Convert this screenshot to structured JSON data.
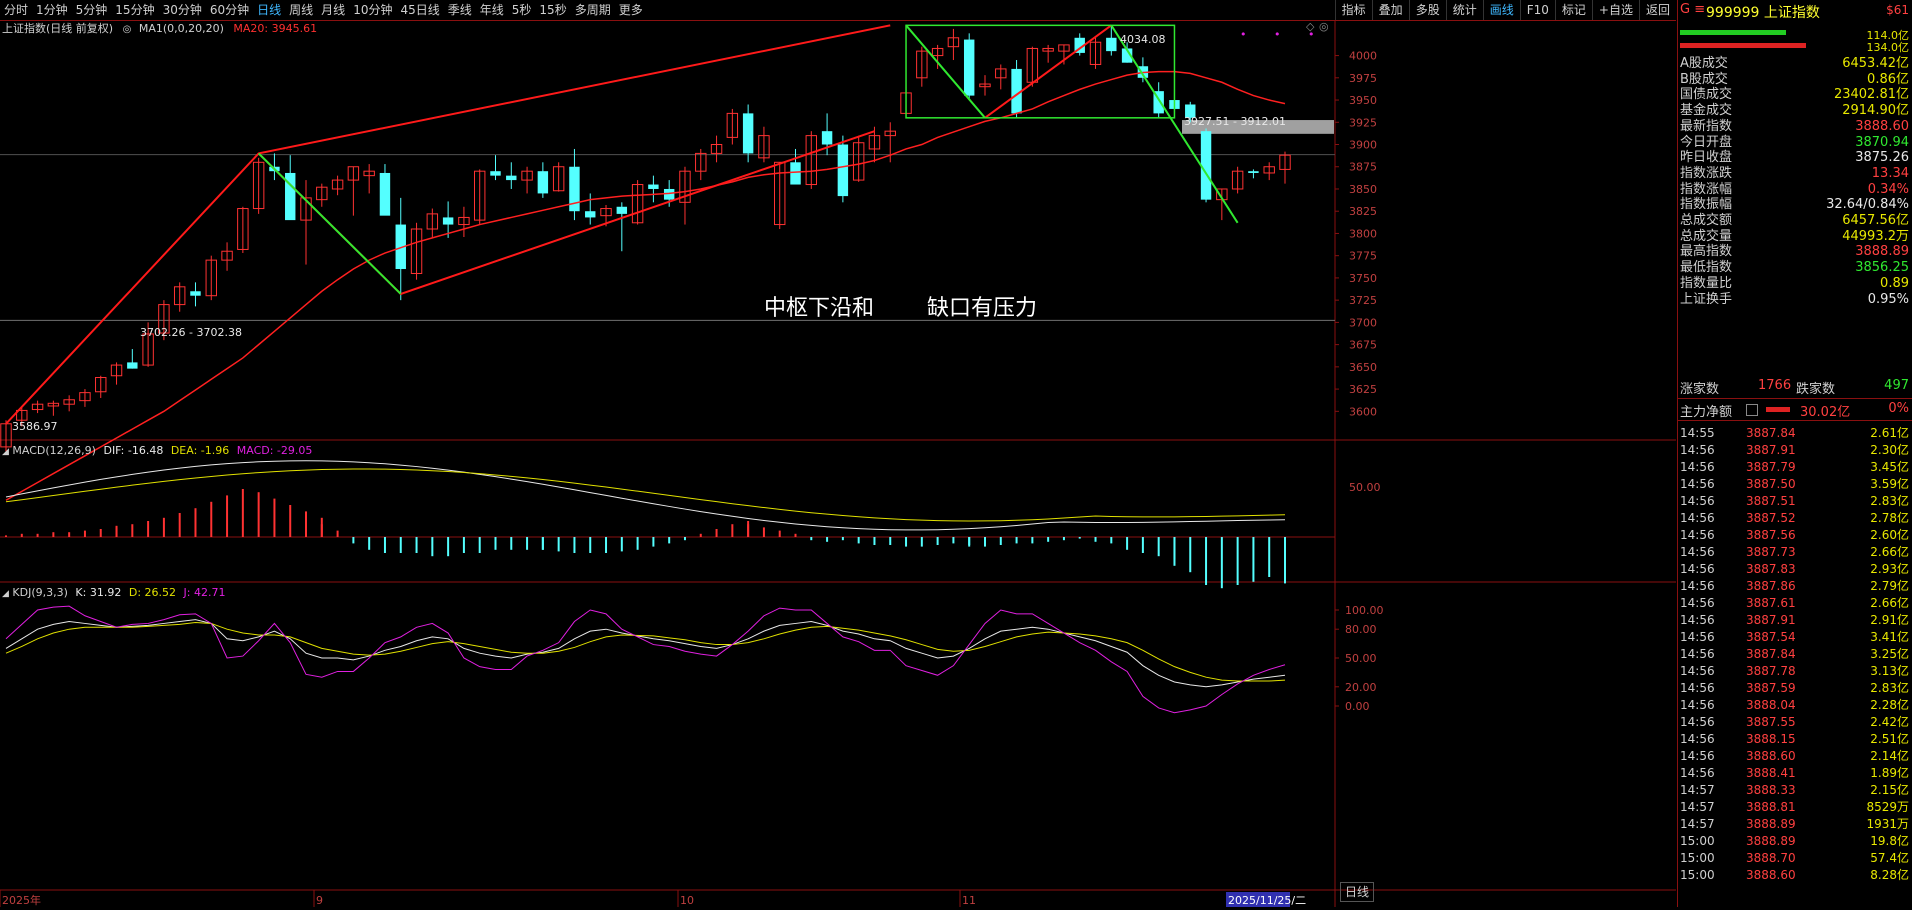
{
  "toolbar": {
    "periods": [
      "分时",
      "1分钟",
      "5分钟",
      "15分钟",
      "30分钟",
      "60分钟",
      "日线",
      "周线",
      "月线",
      "10分钟",
      "45日线",
      "季线",
      "年线",
      "5秒",
      "15秒",
      "多周期",
      "更多"
    ],
    "active_period": "日线",
    "tools": [
      "指标",
      "叠加",
      "多股",
      "统计",
      "画线",
      "F10",
      "标记",
      "+自选",
      "返回"
    ],
    "active_tool": "画线"
  },
  "legend": {
    "title": "上证指数(日线 前复权)",
    "ma1": "MA1(0,0,20,20)",
    "ma20": "MA20: 3945.61"
  },
  "annotations": {
    "text_main": "中枢下沿和",
    "text_gap": "缺口有压力",
    "high_label": "4034.08",
    "gap_label": "3927.51 - 3912.01",
    "zone_label": "3702.26 - 3702.38",
    "low_label": "3586.97"
  },
  "macd": {
    "name": "MACD(12,26,9)",
    "dif": "DIF: -16.48",
    "dea": "DEA: -1.96",
    "macd": "MACD: -29.05"
  },
  "kdj": {
    "name": "KDJ(9,3,3)",
    "k": "K: 31.92",
    "d": "D: 26.52",
    "j": "J: 42.71"
  },
  "x_labels": [
    "2025年",
    "9",
    "10",
    "11",
    "2025/11/25/二"
  ],
  "y_axis": {
    "price": [
      "4000",
      "3975",
      "3950",
      "3925",
      "3900",
      "3875",
      "3850",
      "3825",
      "3800",
      "3775",
      "3750",
      "3725",
      "3700",
      "3675",
      "3650",
      "3625",
      "3600"
    ],
    "macd": [
      "50.00"
    ],
    "kdj": [
      "100.00",
      "80.00",
      "50.00",
      "20.00",
      "0.00"
    ]
  },
  "bottom_tab": "日线",
  "colors": {
    "up": "#ff3232",
    "down": "#54ffff",
    "ma": "#ff2020",
    "green_line": "#30e830",
    "yellow": "#e0e000",
    "white": "#e8e8e8",
    "magenta": "#e020e0"
  },
  "panel": {
    "title": "999999 上证指数",
    "prefix": "G ≡",
    "badge": "$61",
    "bar_values": [
      "114.0亿",
      "134.0亿"
    ],
    "stats": [
      {
        "k": "A股成交",
        "v": "6453.42亿",
        "c": "#e8e800"
      },
      {
        "k": "B股成交",
        "v": "0.86亿",
        "c": "#e8e800"
      },
      {
        "k": "国债成交",
        "v": "23402.81亿",
        "c": "#e8e800"
      },
      {
        "k": "基金成交",
        "v": "2914.90亿",
        "c": "#e8e800"
      },
      {
        "k": "最新指数",
        "v": "3888.60",
        "c": "#ff4040"
      },
      {
        "k": "今日开盘",
        "v": "3870.94",
        "c": "#30e830"
      },
      {
        "k": "昨日收盘",
        "v": "3875.26",
        "c": "#e8e8e8"
      },
      {
        "k": "指数涨跌",
        "v": "13.34",
        "c": "#ff4040"
      },
      {
        "k": "指数涨幅",
        "v": "0.34%",
        "c": "#ff4040"
      },
      {
        "k": "指数振幅",
        "v": "32.64/0.84%",
        "c": "#e8e8e8"
      },
      {
        "k": "总成交额",
        "v": "6457.56亿",
        "c": "#e8e800"
      },
      {
        "k": "总成交量",
        "v": "44993.2万",
        "c": "#e8e800"
      },
      {
        "k": "最高指数",
        "v": "3888.89",
        "c": "#ff4040"
      },
      {
        "k": "最低指数",
        "v": "3856.25",
        "c": "#30e830"
      },
      {
        "k": "指数量比",
        "v": "0.89",
        "c": "#e8e800"
      },
      {
        "k": "上证换手",
        "v": "0.95%",
        "c": "#e8e8e8"
      }
    ],
    "up_count_label": "涨家数",
    "up_count": "1766",
    "down_count_label": "跌家数",
    "down_count": "497",
    "main_flow_label": "主力净额",
    "main_flow": "30.02亿",
    "main_flow_pct": "0%",
    "ticks": [
      {
        "t": "14:55",
        "p": "3887.84",
        "v": "2.61亿"
      },
      {
        "t": "14:56",
        "p": "3887.91",
        "v": "2.30亿"
      },
      {
        "t": "14:56",
        "p": "3887.79",
        "v": "3.45亿"
      },
      {
        "t": "14:56",
        "p": "3887.50",
        "v": "3.59亿"
      },
      {
        "t": "14:56",
        "p": "3887.51",
        "v": "2.83亿"
      },
      {
        "t": "14:56",
        "p": "3887.52",
        "v": "2.78亿"
      },
      {
        "t": "14:56",
        "p": "3887.56",
        "v": "2.60亿"
      },
      {
        "t": "14:56",
        "p": "3887.73",
        "v": "2.66亿"
      },
      {
        "t": "14:56",
        "p": "3887.83",
        "v": "2.93亿"
      },
      {
        "t": "14:56",
        "p": "3887.86",
        "v": "2.79亿"
      },
      {
        "t": "14:56",
        "p": "3887.61",
        "v": "2.66亿"
      },
      {
        "t": "14:56",
        "p": "3887.91",
        "v": "2.91亿"
      },
      {
        "t": "14:56",
        "p": "3887.54",
        "v": "3.41亿"
      },
      {
        "t": "14:56",
        "p": "3887.84",
        "v": "3.25亿"
      },
      {
        "t": "14:56",
        "p": "3887.78",
        "v": "3.13亿"
      },
      {
        "t": "14:56",
        "p": "3887.59",
        "v": "2.83亿"
      },
      {
        "t": "14:56",
        "p": "3888.04",
        "v": "2.28亿"
      },
      {
        "t": "14:56",
        "p": "3887.55",
        "v": "2.42亿"
      },
      {
        "t": "14:56",
        "p": "3888.15",
        "v": "2.51亿"
      },
      {
        "t": "14:56",
        "p": "3888.60",
        "v": "2.14亿"
      },
      {
        "t": "14:56",
        "p": "3888.41",
        "v": "1.89亿"
      },
      {
        "t": "14:57",
        "p": "3888.33",
        "v": "2.15亿"
      },
      {
        "t": "14:57",
        "p": "3888.81",
        "v": "8529万"
      },
      {
        "t": "14:57",
        "p": "3888.89",
        "v": "1931万"
      },
      {
        "t": "15:00",
        "p": "3888.89",
        "v": "19.8亿"
      },
      {
        "t": "15:00",
        "p": "3888.70",
        "v": "57.4亿"
      },
      {
        "t": "15:00",
        "p": "3888.60",
        "v": "8.28亿"
      }
    ]
  },
  "chart_data": {
    "type": "candlestick",
    "candles": [
      [
        3560,
        3590,
        3555,
        3586
      ],
      [
        3590,
        3605,
        3583,
        3601
      ],
      [
        3602,
        3612,
        3598,
        3608
      ],
      [
        3606,
        3612,
        3595,
        3609
      ],
      [
        3608,
        3618,
        3600,
        3613
      ],
      [
        3612,
        3625,
        3605,
        3621
      ],
      [
        3622,
        3640,
        3615,
        3638
      ],
      [
        3640,
        3655,
        3630,
        3652
      ],
      [
        3655,
        3670,
        3648,
        3648
      ],
      [
        3652,
        3700,
        3650,
        3687
      ],
      [
        3688,
        3725,
        3680,
        3720
      ],
      [
        3720,
        3745,
        3712,
        3740
      ],
      [
        3735,
        3745,
        3718,
        3730
      ],
      [
        3730,
        3775,
        3725,
        3770
      ],
      [
        3770,
        3790,
        3758,
        3780
      ],
      [
        3782,
        3830,
        3778,
        3828
      ],
      [
        3828,
        3885,
        3822,
        3880
      ],
      [
        3875,
        3890,
        3860,
        3870
      ],
      [
        3868,
        3888,
        3840,
        3815
      ],
      [
        3815,
        3860,
        3765,
        3840
      ],
      [
        3838,
        3856,
        3830,
        3852
      ],
      [
        3850,
        3865,
        3843,
        3860
      ],
      [
        3860,
        3875,
        3820,
        3875
      ],
      [
        3865,
        3878,
        3845,
        3870
      ],
      [
        3868,
        3878,
        3830,
        3820
      ],
      [
        3810,
        3840,
        3725,
        3760
      ],
      [
        3755,
        3812,
        3748,
        3805
      ],
      [
        3805,
        3828,
        3795,
        3822
      ],
      [
        3818,
        3836,
        3795,
        3810
      ],
      [
        3810,
        3830,
        3796,
        3818
      ],
      [
        3815,
        3872,
        3810,
        3870
      ],
      [
        3870,
        3888,
        3860,
        3865
      ],
      [
        3865,
        3880,
        3850,
        3860
      ],
      [
        3860,
        3875,
        3845,
        3870
      ],
      [
        3870,
        3880,
        3840,
        3845
      ],
      [
        3848,
        3880,
        3847,
        3875
      ],
      [
        3875,
        3895,
        3815,
        3825
      ],
      [
        3825,
        3845,
        3810,
        3818
      ],
      [
        3820,
        3832,
        3808,
        3828
      ],
      [
        3830,
        3835,
        3780,
        3822
      ],
      [
        3812,
        3860,
        3810,
        3855
      ],
      [
        3855,
        3865,
        3835,
        3850
      ],
      [
        3850,
        3860,
        3830,
        3838
      ],
      [
        3835,
        3875,
        3810,
        3870
      ],
      [
        3870,
        3895,
        3860,
        3890
      ],
      [
        3890,
        3910,
        3880,
        3900
      ],
      [
        3908,
        3940,
        3900,
        3935
      ],
      [
        3935,
        3945,
        3880,
        3890
      ],
      [
        3885,
        3920,
        3880,
        3910
      ],
      [
        3810,
        3880,
        3805,
        3880
      ],
      [
        3880,
        3895,
        3860,
        3855
      ],
      [
        3855,
        3915,
        3850,
        3910
      ],
      [
        3915,
        3935,
        3888,
        3900
      ],
      [
        3900,
        3910,
        3835,
        3842
      ],
      [
        3860,
        3910,
        3858,
        3902
      ],
      [
        3895,
        3920,
        3880,
        3910
      ],
      [
        3910,
        3925,
        3880,
        3915
      ],
      [
        3935,
        3965,
        3930,
        3958
      ],
      [
        3975,
        4010,
        3965,
        4005
      ],
      [
        4000,
        4012,
        3985,
        4008
      ],
      [
        4010,
        4030,
        3995,
        4020
      ],
      [
        4018,
        4025,
        3950,
        3955
      ],
      [
        3965,
        3978,
        3955,
        3968
      ],
      [
        3975,
        3990,
        3962,
        3985
      ],
      [
        3985,
        3995,
        3930,
        3935
      ],
      [
        3970,
        4010,
        3965,
        4008
      ],
      [
        4005,
        4012,
        3992,
        4008
      ],
      [
        4005,
        4012,
        3990,
        4012
      ],
      [
        4020,
        4025,
        4000,
        4003
      ],
      [
        3990,
        4020,
        3985,
        4015
      ],
      [
        4020,
        4034,
        4000,
        4005
      ],
      [
        4008,
        4015,
        3992,
        3992
      ],
      [
        3988,
        3998,
        3970,
        3975
      ],
      [
        3960,
        3970,
        3930,
        3935
      ],
      [
        3950,
        3958,
        3930,
        3940
      ],
      [
        3945,
        3948,
        3925,
        3930
      ],
      [
        3915,
        3918,
        3835,
        3838
      ],
      [
        3838,
        3850,
        3815,
        3850
      ],
      [
        3850,
        3875,
        3845,
        3870
      ],
      [
        3870,
        3872,
        3862,
        3868
      ],
      [
        3868,
        3880,
        3860,
        3875
      ],
      [
        3872,
        3892,
        3856,
        3888
      ]
    ],
    "ma20": [
      3500,
      3510,
      3520,
      3530,
      3540,
      3550,
      3560,
      3570,
      3580,
      3590,
      3600,
      3612,
      3624,
      3636,
      3648,
      3660,
      3675,
      3690,
      3705,
      3720,
      3735,
      3748,
      3760,
      3770,
      3778,
      3784,
      3790,
      3795,
      3800,
      3805,
      3810,
      3814,
      3818,
      3822,
      3826,
      3830,
      3834,
      3838,
      3840,
      3842,
      3843,
      3844,
      3845,
      3847,
      3850,
      3854,
      3858,
      3863,
      3866,
      3868,
      3869,
      3870,
      3872,
      3875,
      3878,
      3882,
      3888,
      3895,
      3900,
      3908,
      3914,
      3920,
      3926,
      3930,
      3935,
      3940,
      3948,
      3955,
      3962,
      3968,
      3973,
      3978,
      3981,
      3982,
      3982,
      3980,
      3975,
      3970,
      3962,
      3955,
      3950,
      3946
    ],
    "macd_hist": [
      1,
      2,
      2,
      3,
      3,
      4,
      5,
      6,
      7,
      8,
      10,
      12,
      15,
      18,
      22,
      26,
      30,
      28,
      24,
      20,
      16,
      12,
      8,
      4,
      -4,
      -8,
      -10,
      -10,
      -10,
      -12,
      -12,
      -10,
      -10,
      -8,
      -8,
      -8,
      -8,
      -8,
      -9,
      -10,
      -10,
      -10,
      -9,
      -8,
      -6,
      -4,
      -2,
      2,
      5,
      8,
      10,
      8,
      6,
      4,
      2,
      -2,
      -3,
      -2,
      -4,
      -5,
      -5,
      -6,
      -6,
      -5,
      -4,
      -5,
      -6,
      -6,
      -5,
      -4,
      -4,
      -3,
      -2,
      -1,
      -3,
      -4,
      -8,
      -10,
      -12,
      -14,
      -18,
      -22,
      -30,
      -32,
      -30,
      -28,
      -25,
      -29
    ],
    "kdj_k": [
      60,
      70,
      80,
      85,
      88,
      86,
      84,
      82,
      83,
      84,
      86,
      88,
      90,
      86,
      70,
      68,
      72,
      78,
      70,
      55,
      50,
      50,
      48,
      52,
      58,
      62,
      68,
      72,
      70,
      60,
      55,
      52,
      50,
      54,
      56,
      60,
      70,
      78,
      80,
      76,
      70,
      68,
      65,
      62,
      60,
      64,
      70,
      78,
      84,
      86,
      88,
      84,
      78,
      75,
      70,
      68,
      60,
      55,
      50,
      52,
      60,
      70,
      78,
      80,
      82,
      80,
      76,
      72,
      68,
      62,
      56,
      42,
      32,
      25,
      22,
      20,
      22,
      25,
      28,
      30,
      32
    ],
    "kdj_d": [
      55,
      62,
      70,
      76,
      80,
      82,
      82,
      82,
      82,
      83,
      84,
      85,
      87,
      86,
      80,
      76,
      74,
      74,
      72,
      66,
      60,
      57,
      54,
      53,
      54,
      57,
      61,
      65,
      67,
      65,
      62,
      59,
      56,
      55,
      55,
      57,
      61,
      67,
      72,
      74,
      73,
      71,
      69,
      66,
      64,
      64,
      66,
      70,
      75,
      79,
      82,
      83,
      81,
      79,
      76,
      73,
      69,
      64,
      59,
      57,
      58,
      62,
      67,
      72,
      75,
      77,
      76,
      75,
      73,
      70,
      66,
      58,
      49,
      41,
      35,
      30,
      27,
      26,
      26,
      26,
      27
    ],
    "kdj_j": [
      70,
      85,
      100,
      103,
      104,
      94,
      88,
      82,
      85,
      86,
      90,
      95,
      96,
      86,
      50,
      52,
      68,
      86,
      66,
      33,
      30,
      36,
      36,
      50,
      66,
      72,
      82,
      86,
      76,
      50,
      41,
      38,
      38,
      52,
      58,
      66,
      88,
      100,
      96,
      80,
      64,
      62,
      57,
      54,
      52,
      64,
      78,
      94,
      102,
      100,
      100,
      86,
      72,
      67,
      58,
      58,
      42,
      37,
      32,
      42,
      64,
      86,
      100,
      96,
      96,
      86,
      76,
      66,
      58,
      46,
      36,
      10,
      -2,
      -7,
      -4,
      0,
      12,
      23,
      32,
      38,
      43
    ],
    "ylim_price": [
      3570,
      4040
    ]
  }
}
